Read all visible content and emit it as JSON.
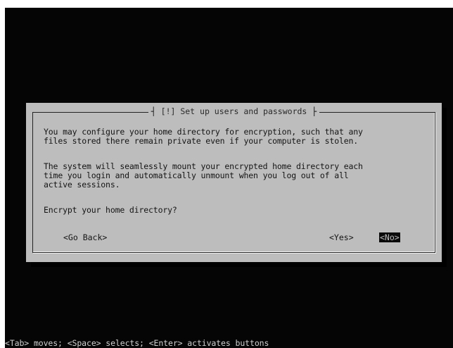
{
  "dialog": {
    "title": "[!] Set up users and passwords",
    "paragraph1": "You may configure your home directory for encryption, such that any\nfiles stored there remain private even if your computer is stolen.",
    "paragraph2": "The system will seamlessly mount your encrypted home directory each\ntime you login and automatically unmount when you log out of all\nactive sessions.",
    "question": "Encrypt your home directory?",
    "buttons": {
      "go_back": "<Go Back>",
      "yes": "<Yes>",
      "no": "<No>"
    },
    "selected_button": "no"
  },
  "status_line": "<Tab> moves; <Space> selects; <Enter> activates buttons",
  "colors": {
    "screen_background": "#050505",
    "dialog_background": "#bdbdbd",
    "text": "#141414",
    "selected_button_background": "#0a0a0a",
    "status_text": "#cfcfcf"
  }
}
